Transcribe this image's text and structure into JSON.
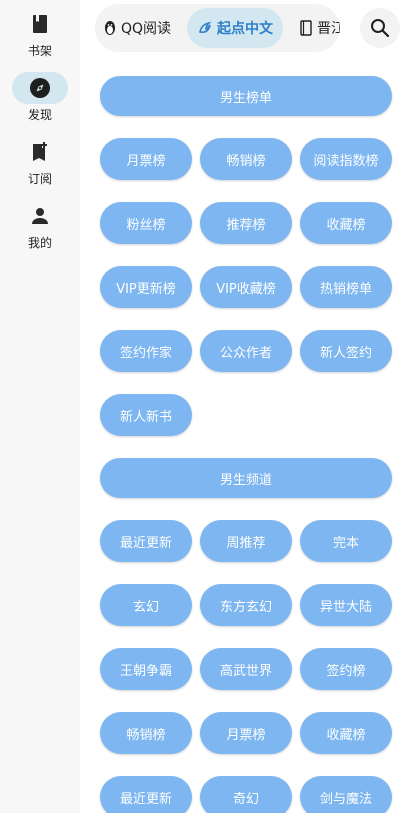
{
  "nav": {
    "items": [
      {
        "label": "书架",
        "icon": "bookshelf-icon"
      },
      {
        "label": "发现",
        "icon": "compass-icon",
        "active": true
      },
      {
        "label": "订阅",
        "icon": "bookmark-add-icon"
      },
      {
        "label": "我的",
        "icon": "person-icon"
      }
    ]
  },
  "sources": {
    "tabs": [
      {
        "label": "QQ阅读"
      },
      {
        "label": "起点中文",
        "selected": true
      },
      {
        "label": "晋江"
      }
    ]
  },
  "colors": {
    "accent": "#2f80c8",
    "chip": "#7db6f0",
    "selected_bg": "#d3e7f0",
    "rail_bg": "#f7f7f7"
  },
  "sections": [
    {
      "title": "男生榜单",
      "items": [
        "月票榜",
        "畅销榜",
        "阅读指数榜",
        "粉丝榜",
        "推荐榜",
        "收藏榜",
        "VIP更新榜",
        "VIP收藏榜",
        "热销榜单",
        "签约作家",
        "公众作者",
        "新人签约",
        "新人新书"
      ]
    },
    {
      "title": "男生频道",
      "items": [
        "最近更新",
        "周推荐",
        "完本",
        "玄幻",
        "东方玄幻",
        "异世大陆",
        "王朝争霸",
        "高武世界",
        "签约榜",
        "畅销榜",
        "月票榜",
        "收藏榜",
        "最近更新",
        "奇幻",
        "剑与魔法"
      ]
    }
  ]
}
